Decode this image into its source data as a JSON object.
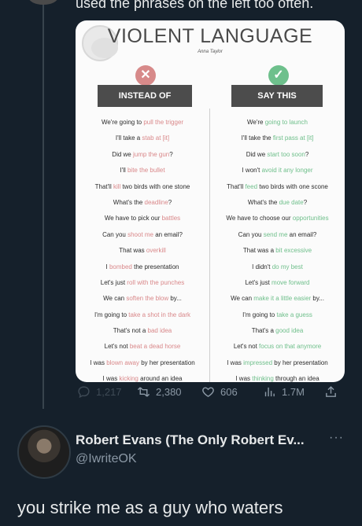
{
  "tweet": {
    "text_fragment": "used the phrases on the left too often."
  },
  "card": {
    "title": "VIOLENT LANGUAGE",
    "author": "Anna Taylor",
    "left_header": "INSTEAD OF",
    "right_header": "SAY THIS",
    "rows": [
      {
        "left": [
          [
            "We're going to ",
            ""
          ],
          [
            "pull the trigger",
            "r"
          ]
        ],
        "right": [
          [
            "We're ",
            ""
          ],
          [
            "going to launch",
            "g"
          ]
        ]
      },
      {
        "left": [
          [
            "I'll take a ",
            ""
          ],
          [
            "stab at [it]",
            "r"
          ]
        ],
        "right": [
          [
            "I'll take the ",
            ""
          ],
          [
            "first pass at [it]",
            "g"
          ]
        ]
      },
      {
        "left": [
          [
            "Did we ",
            ""
          ],
          [
            "jump the gun",
            "r"
          ],
          [
            "?",
            ""
          ]
        ],
        "right": [
          [
            "Did we ",
            ""
          ],
          [
            "start too soon",
            "g"
          ],
          [
            "?",
            ""
          ]
        ]
      },
      {
        "left": [
          [
            "I'll ",
            ""
          ],
          [
            "bite the bullet",
            "r"
          ]
        ],
        "right": [
          [
            "I won't ",
            ""
          ],
          [
            "avoid it any longer",
            "g"
          ]
        ]
      },
      {
        "left": [
          [
            "That'll ",
            ""
          ],
          [
            "kill",
            "r"
          ],
          [
            " two birds with one stone",
            ""
          ]
        ],
        "right": [
          [
            "That'll ",
            ""
          ],
          [
            "feed",
            "g"
          ],
          [
            " two birds with one scone",
            ""
          ]
        ]
      },
      {
        "left": [
          [
            "What's the ",
            ""
          ],
          [
            "deadline",
            "r"
          ],
          [
            "?",
            ""
          ]
        ],
        "right": [
          [
            "What's the ",
            ""
          ],
          [
            "due date",
            "g"
          ],
          [
            "?",
            ""
          ]
        ]
      },
      {
        "left": [
          [
            "We have to pick our ",
            ""
          ],
          [
            "battles",
            "r"
          ]
        ],
        "right": [
          [
            "We have to choose our ",
            ""
          ],
          [
            "opportunities",
            "g"
          ]
        ]
      },
      {
        "left": [
          [
            "Can you ",
            ""
          ],
          [
            "shoot me",
            "r"
          ],
          [
            " an email?",
            ""
          ]
        ],
        "right": [
          [
            "Can you ",
            ""
          ],
          [
            "send me",
            "g"
          ],
          [
            " an email?",
            ""
          ]
        ]
      },
      {
        "left": [
          [
            "That was ",
            ""
          ],
          [
            "overkill",
            "r"
          ]
        ],
        "right": [
          [
            "That was a ",
            ""
          ],
          [
            "bit excessive",
            "g"
          ]
        ]
      },
      {
        "left": [
          [
            "I ",
            ""
          ],
          [
            "bombed",
            "r"
          ],
          [
            " the presentation",
            ""
          ]
        ],
        "right": [
          [
            "I didn't ",
            ""
          ],
          [
            "do my best",
            "g"
          ]
        ]
      },
      {
        "left": [
          [
            "Let's just ",
            ""
          ],
          [
            "roll with the punches",
            "r"
          ]
        ],
        "right": [
          [
            "Let's just ",
            ""
          ],
          [
            "move forward",
            "g"
          ]
        ]
      },
      {
        "left": [
          [
            "We can ",
            ""
          ],
          [
            "soften the blow",
            "r"
          ],
          [
            " by...",
            ""
          ]
        ],
        "right": [
          [
            "We can ",
            ""
          ],
          [
            "make it a little easier",
            "g"
          ],
          [
            " by...",
            ""
          ]
        ]
      },
      {
        "left": [
          [
            "I'm going to ",
            ""
          ],
          [
            "take a shot in the dark",
            "r"
          ]
        ],
        "right": [
          [
            "I'm going to ",
            ""
          ],
          [
            "take a guess",
            "g"
          ]
        ]
      },
      {
        "left": [
          [
            "That's not a ",
            ""
          ],
          [
            "bad idea",
            "r"
          ]
        ],
        "right": [
          [
            "That's a ",
            ""
          ],
          [
            "good idea",
            "g"
          ]
        ]
      },
      {
        "left": [
          [
            "Let's not ",
            ""
          ],
          [
            "beat a dead horse",
            "r"
          ]
        ],
        "right": [
          [
            "Let's not ",
            ""
          ],
          [
            "focus on that anymore",
            "g"
          ]
        ]
      },
      {
        "left": [
          [
            "I was ",
            ""
          ],
          [
            "blown away",
            "r"
          ],
          [
            " by her presentation",
            ""
          ]
        ],
        "right": [
          [
            "I was ",
            ""
          ],
          [
            "impressed",
            "g"
          ],
          [
            " by her presentation",
            ""
          ]
        ]
      },
      {
        "left": [
          [
            "I was ",
            ""
          ],
          [
            "kicking",
            "r"
          ],
          [
            " around an idea",
            ""
          ]
        ],
        "right": [
          [
            "I was ",
            ""
          ],
          [
            "thinking",
            "g"
          ],
          [
            " through an idea",
            ""
          ]
        ]
      }
    ]
  },
  "metrics": {
    "replies": "1,217",
    "retweets": "2,380",
    "likes": "606",
    "views": "1.7M"
  },
  "reply": {
    "display_name": "Robert Evans (The Only Robert Ev...",
    "handle": "@IwriteOK",
    "more": "···",
    "text": "you strike me as a guy who waters"
  },
  "colors": {
    "background": "#15202b",
    "highlight_red": "#d9888a",
    "highlight_green": "#6fbf8b",
    "header_bg": "#4c4c4c"
  }
}
